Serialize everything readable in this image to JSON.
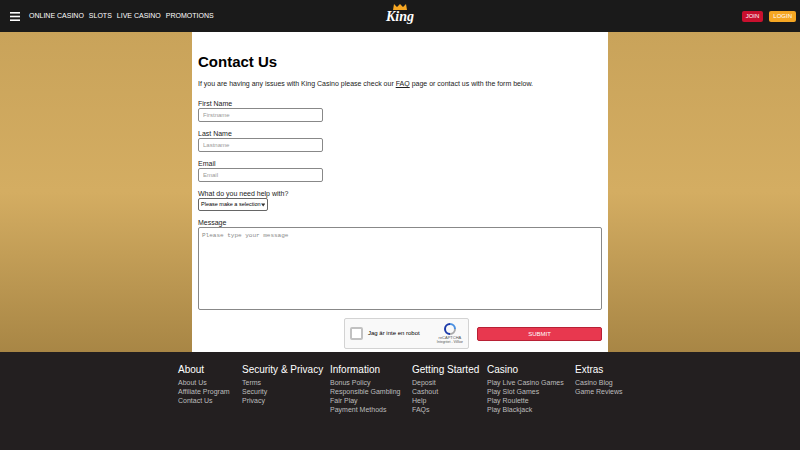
{
  "nav": {
    "links": [
      "ONLINE CASINO",
      "SLOTS",
      "LIVE CASINO",
      "PROMOTIONS"
    ],
    "logo": "King",
    "buttons": [
      {
        "label": "JOIN",
        "color": "#c8102e"
      },
      {
        "label": "LOGIN",
        "color": "#f5a623"
      }
    ]
  },
  "contact": {
    "title": "Contact Us",
    "intro_before": "If you are having any issues with King Casino please check our ",
    "intro_link": "FAQ",
    "intro_after": " page or contact us with the form below.",
    "fields": [
      {
        "kind": "text",
        "label": "First Name",
        "placeholder": "Firstname"
      },
      {
        "kind": "text",
        "label": "Last Name",
        "placeholder": "Lastname"
      },
      {
        "kind": "text",
        "label": "Email",
        "placeholder": "Email"
      },
      {
        "kind": "select",
        "label": "What do you need help with?",
        "value": "Please make a selection"
      },
      {
        "kind": "textarea",
        "label": "Message",
        "placeholder": "Please type your message"
      }
    ],
    "captcha": {
      "label": "Jag är inte en robot",
      "brand": "reCAPTCHA",
      "links": "Integritet - Villkor",
      "checked": false
    },
    "submit": "SUBMIT"
  },
  "footer": {
    "columns": [
      {
        "heading": "About",
        "items": [
          "About Us",
          "Affiliate Program",
          "Contact Us"
        ]
      },
      {
        "heading": "Security & Privacy",
        "items": [
          "Terms",
          "Security",
          "Privacy"
        ]
      },
      {
        "heading": "Information",
        "items": [
          "Bonus Policy",
          "Responsible Gambling",
          "Fair Play",
          "Payment Methods"
        ]
      },
      {
        "heading": "Getting Started",
        "items": [
          "Deposit",
          "Cashout",
          "Help",
          "FAQs"
        ]
      },
      {
        "heading": "Casino",
        "items": [
          "Play Live Casino Games",
          "Play Slot Games",
          "Play Roulette",
          "Play Blackjack"
        ]
      },
      {
        "heading": "Extras",
        "items": [
          "Casino Blog",
          "Game Reviews"
        ]
      }
    ]
  }
}
